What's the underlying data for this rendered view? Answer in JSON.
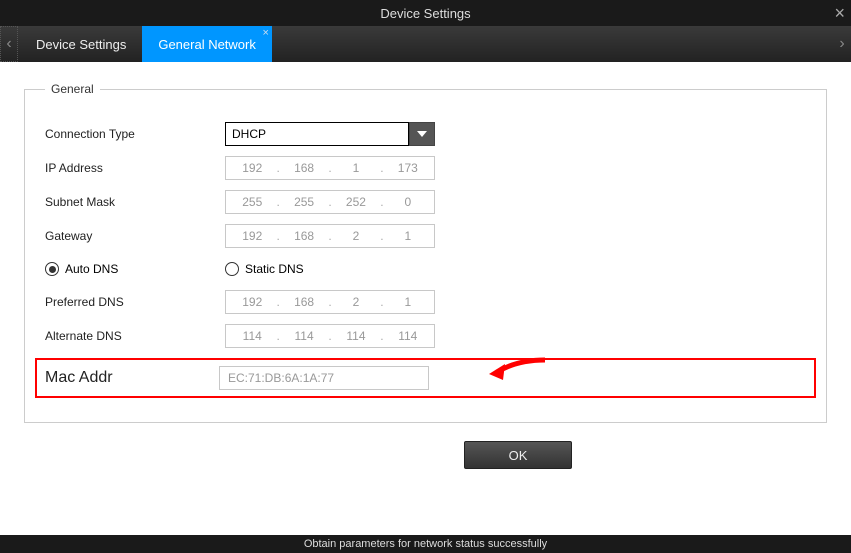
{
  "window": {
    "title": "Device Settings"
  },
  "tabs": {
    "left_arrow": "‹",
    "right_arrow": "›",
    "items": [
      {
        "label": "Device Settings"
      },
      {
        "label": "General Network"
      }
    ]
  },
  "general": {
    "legend": "General",
    "connection_type": {
      "label": "Connection Type",
      "value": "DHCP"
    },
    "ip_address": {
      "label": "IP Address",
      "a": "192",
      "b": "168",
      "c": "1",
      "d": "173"
    },
    "subnet_mask": {
      "label": "Subnet Mask",
      "a": "255",
      "b": "255",
      "c": "252",
      "d": "0"
    },
    "gateway": {
      "label": "Gateway",
      "a": "192",
      "b": "168",
      "c": "2",
      "d": "1"
    },
    "dns_mode": {
      "auto": "Auto DNS",
      "static": "Static DNS"
    },
    "preferred_dns": {
      "label": "Preferred DNS",
      "a": "192",
      "b": "168",
      "c": "2",
      "d": "1"
    },
    "alternate_dns": {
      "label": "Alternate DNS",
      "a": "114",
      "b": "114",
      "c": "114",
      "d": "114"
    },
    "mac_addr": {
      "label": "Mac Addr",
      "value": "EC:71:DB:6A:1A:77"
    }
  },
  "buttons": {
    "ok": "OK"
  },
  "status": {
    "text": "Obtain parameters for network status successfully"
  }
}
